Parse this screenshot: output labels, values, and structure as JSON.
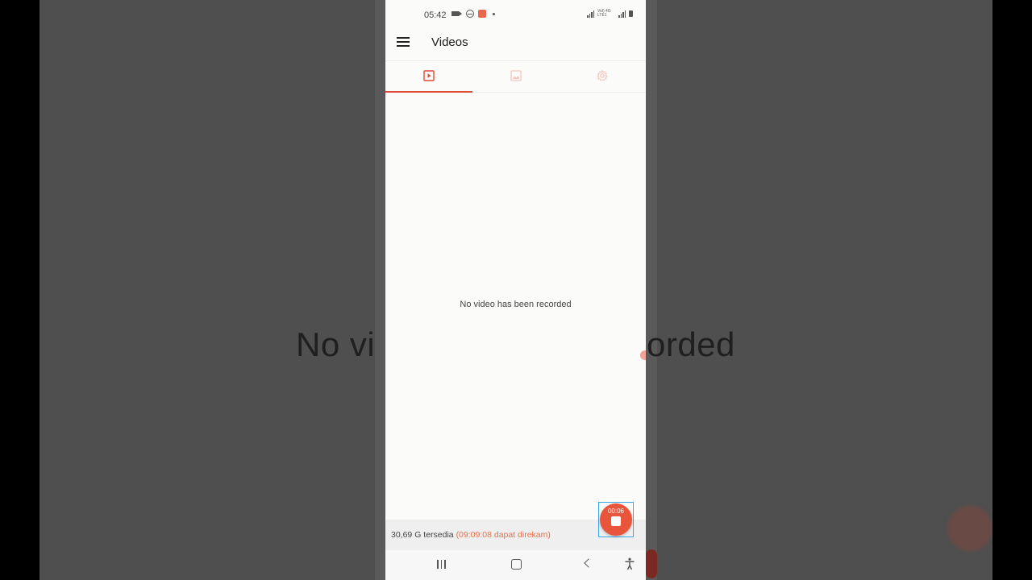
{
  "status_bar": {
    "time": "05:42",
    "network_label": "Vol) 4G LTE1"
  },
  "app_bar": {
    "title": "Videos",
    "menu_icon": "hamburger-menu-icon"
  },
  "tabs": [
    {
      "icon": "video-icon",
      "active": true
    },
    {
      "icon": "image-icon",
      "active": false
    },
    {
      "icon": "gear-icon",
      "active": false
    }
  ],
  "main": {
    "empty_message": "No video has been recorded"
  },
  "background": {
    "blurred_text_left": "No vi",
    "blurred_text_right": "orded"
  },
  "footer": {
    "storage_text": "30,69 G tersedia",
    "record_time_text": "(09:09:08 dapat direkam)"
  },
  "record_button": {
    "timer": "00:06"
  },
  "colors": {
    "accent": "#e04a38",
    "record": "#e9553b",
    "footer_highlight": "#e5704c",
    "screen_bg": "#fbfbf9",
    "outer_bg": "#4f4f4f"
  }
}
